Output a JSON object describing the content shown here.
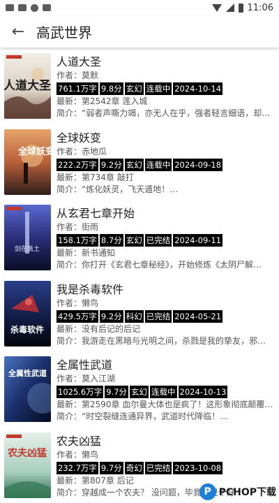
{
  "status_bar": {
    "time": "11:06"
  },
  "header": {
    "title": "高武世界"
  },
  "books": [
    {
      "title": "人道大圣",
      "author": "作者：莫默",
      "tags": [
        "761.1万字",
        "9.8分",
        "玄幻",
        "连载中",
        "2024-10-14"
      ],
      "latest": "最新：第2542章 莲入城",
      "intro": "简介：“弱者声嘶力竭，亦无人在乎，强者轻言细语，却…",
      "cover_colors": [
        "#e9e4dc",
        "#6b4a3a"
      ]
    },
    {
      "title": "全球妖变",
      "author": "作者：赤地瓜",
      "tags": [
        "222.2万字",
        "9.2分",
        "玄幻",
        "连载中",
        "2024-09-18"
      ],
      "latest": "最新：第734章 敲打",
      "intro": "简介：“炼化妖灵，飞天遁地！…",
      "cover_colors": [
        "#d98a5a",
        "#3a2620"
      ]
    },
    {
      "title": "从玄君七章开始",
      "author": "作者：街雨",
      "tags": [
        "158.1万字",
        "8.7分",
        "玄幻",
        "已完结",
        "2024-09-11"
      ],
      "latest": "最新：新书通知",
      "intro": "简介：你打开《玄君七章秘经》，开始修炼《太阴尸解…",
      "cover_colors": [
        "#3a3f8a",
        "#0e1230"
      ]
    },
    {
      "title": "我是杀毒软件",
      "author": "作者：懒鸟",
      "tags": [
        "429.5万字",
        "9.2分",
        "科幻",
        "已完结",
        "2024-05-21"
      ],
      "latest": "最新：没有后记的后记",
      "intro": "简介：我游走在黑暗与光明之间，杀戮是我的挚友，邪…",
      "cover_colors": [
        "#1a2a5a",
        "#050812"
      ]
    },
    {
      "title": "全属性武道",
      "author": "作者：莫入江湖",
      "tags": [
        "1025.6万字",
        "9.7分",
        "玄幻",
        "连载中",
        "2024-10-13"
      ],
      "latest": "最新：第2590章 血尔曼大体也是疯了！这形象彻底颠覆…",
      "intro": "简介：“时空裂缝连通异界，武道时代降临！…",
      "cover_colors": [
        "#2a4a8a",
        "#0a1a3a"
      ]
    },
    {
      "title": "农夫凶猛",
      "author": "作者：懒鸟",
      "tags": [
        "232.7万字",
        "9.7分",
        "奇幻",
        "已完结",
        "2023-10-08"
      ],
      "latest": "最新：第807章 后记",
      "intro": "简介：穿越成一个农夫？ 没问题，毕竟我是个好",
      "cover_colors": [
        "#d8e6e0",
        "#2a7a5a"
      ]
    }
  ],
  "cover_titles": [
    "人道大圣",
    "全球妖变",
    "剑在焦土",
    "杀毒软件",
    "全属性武道",
    "农夫凶猛"
  ],
  "watermark": {
    "logo": "P",
    "text": "PCHOP下载"
  }
}
